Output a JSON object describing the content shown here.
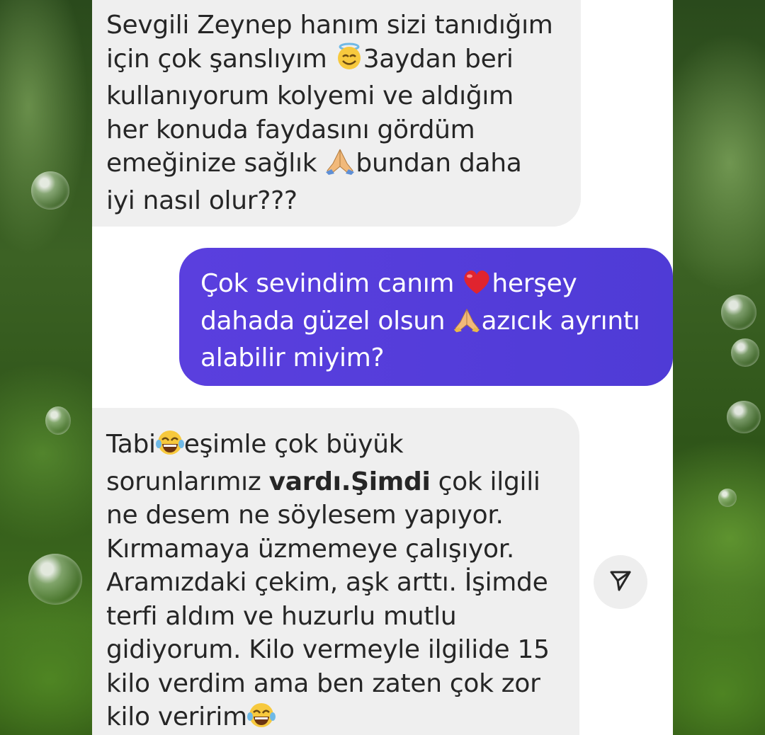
{
  "messages": [
    {
      "direction": "incoming",
      "lines": [
        [
          "Sevgili Zeynep hanım sizi tanıdığım"
        ],
        [
          "için çok şanslıyım ",
          "3aydan beri"
        ],
        [
          "kullanıyorum kolyemi ve aldığım"
        ],
        [
          "her konuda faydasını gördüm"
        ],
        [
          "emeğinize sağlık ",
          "bundan daha"
        ],
        [
          "iyi nasıl olur???"
        ]
      ],
      "emojis": [
        "smiling-face-with-halo-icon",
        "folded-hands-icon"
      ]
    },
    {
      "direction": "outgoing",
      "lines": [
        [
          "Çok sevindim canım ",
          "herşey"
        ],
        [
          "dahada güzel olsun ",
          "azıcık ayrıntı"
        ],
        [
          "alabilir miyim?"
        ]
      ],
      "emojis": [
        "red-heart-icon",
        "folded-hands-icon"
      ]
    },
    {
      "direction": "incoming",
      "lines": [
        [
          "Tabi",
          "eşimle çok büyük"
        ],
        [
          "sorunlarımız ",
          "vardı.Şimdi",
          " çok ilgili"
        ],
        [
          "ne desem ne söylesem yapıyor."
        ],
        [
          "Kırmamaya üzmemeye çalışıyor."
        ],
        [
          "Aramızdaki çekim, aşk arttı. İşimde"
        ],
        [
          "terfi aldım ve huzurlu mutlu"
        ],
        [
          "gidiyorum. Kilo vermeyle ilgilide 15"
        ],
        [
          "kilo verdim ama ben zaten çok zor"
        ],
        [
          "kilo veririm"
        ]
      ],
      "emojis": [
        "face-with-tears-of-joy-icon",
        "face-with-tears-of-joy-icon"
      ]
    }
  ],
  "share_button": {
    "icon": "send-share-icon"
  },
  "colors": {
    "incoming_bubble": "#efefef",
    "outgoing_bubble": "#5a3fde",
    "incoming_text": "#262626",
    "outgoing_text": "#ffffff"
  }
}
